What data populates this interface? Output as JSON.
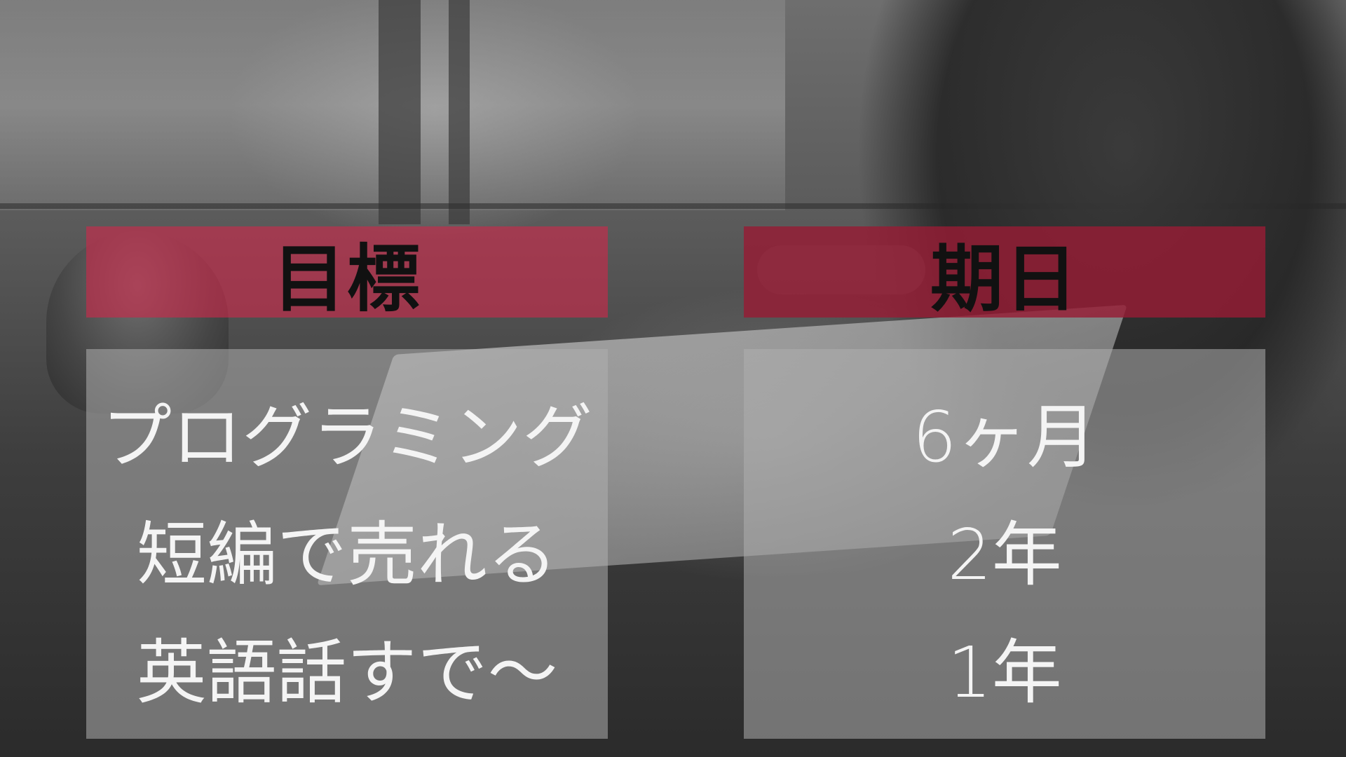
{
  "columns": [
    {
      "header": "目標",
      "items": [
        "プログラミング",
        "短編で売れる",
        "英語話すで〜"
      ]
    },
    {
      "header": "期日",
      "items": [
        "6ヶ月",
        "2年",
        "1年"
      ]
    }
  ],
  "colors": {
    "header_accent": "#cd284b",
    "panel_gray": "#afafaf",
    "text_light": "#f4f4f4",
    "header_text": "#111111"
  }
}
